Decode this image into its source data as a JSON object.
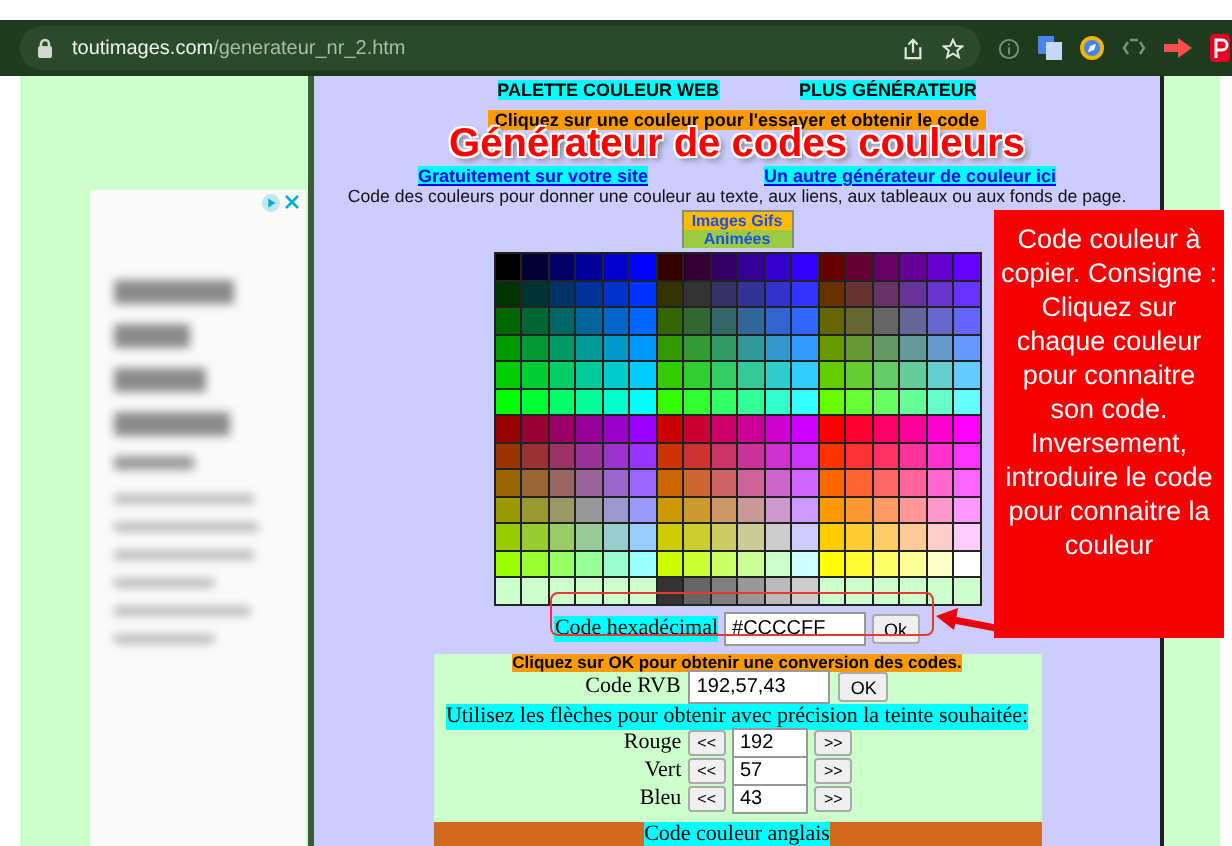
{
  "browser": {
    "url_host": "toutimages.com",
    "url_path": "/generateur_nr_2.htm"
  },
  "page": {
    "nav_links": [
      "PALETTE COULEUR WEB",
      "PLUS GÉNÉRATEUR"
    ],
    "hint": "Cliquez sur une couleur pour l'essayer et obtenir le code",
    "title": "Générateur de codes couleurs",
    "links": [
      "Gratuitement sur votre site",
      "Un autre générateur de couleur ici"
    ],
    "description": "Code des couleurs pour donner une couleur au texte, aux liens, aux tableaux ou aux fonds de page.",
    "gif_button": [
      "Images Gifs",
      "Animées"
    ],
    "hex": {
      "label": "Code hexadécimal",
      "value": "#CCCCFF",
      "button": "Ok"
    },
    "converter": {
      "instruction": "Cliquez sur OK pour obtenir une conversion des codes.",
      "rgb": {
        "label": "Code RVB",
        "value": "192,57,43",
        "button": "OK"
      },
      "arrows_hint": "Utilisez les flèches pour obtenir avec précision la teinte souhaitée:",
      "channels": [
        {
          "label": "Rouge",
          "dec": "<<",
          "value": "192",
          "inc": ">>"
        },
        {
          "label": "Vert",
          "dec": "<<",
          "value": "57",
          "inc": ">>"
        },
        {
          "label": "Bleu",
          "dec": "<<",
          "value": "43",
          "inc": ">>"
        }
      ],
      "footer": "Code couleur anglais"
    }
  },
  "annotation": {
    "text": "Code couleur à copier. Consigne : Cliquez sur chaque couleur pour connaitre son code. Inversement, introduire le code pour connaitre la couleur"
  }
}
